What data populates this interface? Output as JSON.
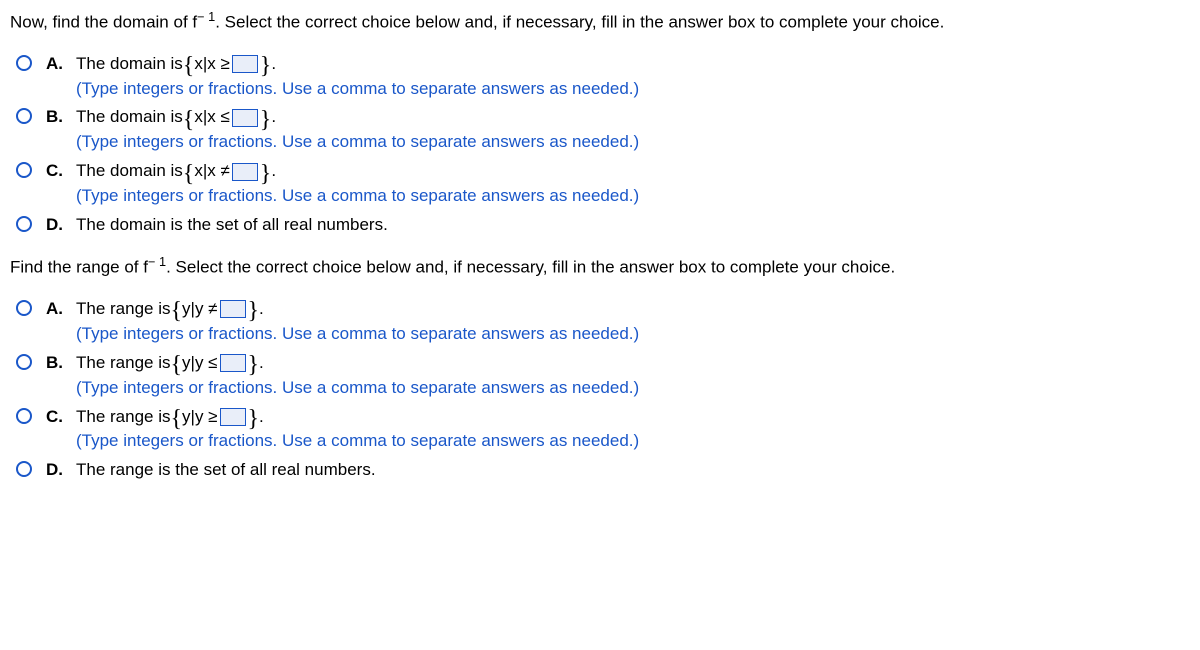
{
  "q1": {
    "prompt_pre": "Now, find the domain of f",
    "prompt_exp": "− 1",
    "prompt_post": ". Select the correct choice below and, if necessary, fill in the answer box to complete your choice.",
    "options": {
      "A": {
        "lead": "The domain is ",
        "set_pre": "x|x ≥ ",
        "tail": ".",
        "hint": "(Type integers or fractions. Use a comma to separate answers as needed.)"
      },
      "B": {
        "lead": "The domain is ",
        "set_pre": "x|x ≤ ",
        "tail": ".",
        "hint": "(Type integers or fractions. Use a comma to separate answers as needed.)"
      },
      "C": {
        "lead": "The domain is ",
        "set_pre": "x|x ≠ ",
        "tail": ".",
        "hint": "(Type integers or fractions. Use a comma to separate answers as needed.)"
      },
      "D": {
        "lead": "The domain is the set of all real numbers."
      }
    }
  },
  "q2": {
    "prompt_pre": "Find the range of f",
    "prompt_exp": "− 1",
    "prompt_post": ". Select the correct choice below and, if necessary, fill in the answer box to complete your choice.",
    "options": {
      "A": {
        "lead": "The range is ",
        "set_pre": "y|y ≠ ",
        "tail": ".",
        "hint": "(Type integers or fractions. Use a comma to separate answers as needed.)"
      },
      "B": {
        "lead": "The range is ",
        "set_pre": "y|y ≤ ",
        "tail": ".",
        "hint": "(Type integers or fractions. Use a comma to separate answers as needed.)"
      },
      "C": {
        "lead": "The range is ",
        "set_pre": "y|y ≥ ",
        "tail": ".",
        "hint": "(Type integers or fractions. Use a comma to separate answers as needed.)"
      },
      "D": {
        "lead": "The range is the set of all real numbers."
      }
    }
  },
  "letters": {
    "A": "A.",
    "B": "B.",
    "C": "C.",
    "D": "D."
  }
}
